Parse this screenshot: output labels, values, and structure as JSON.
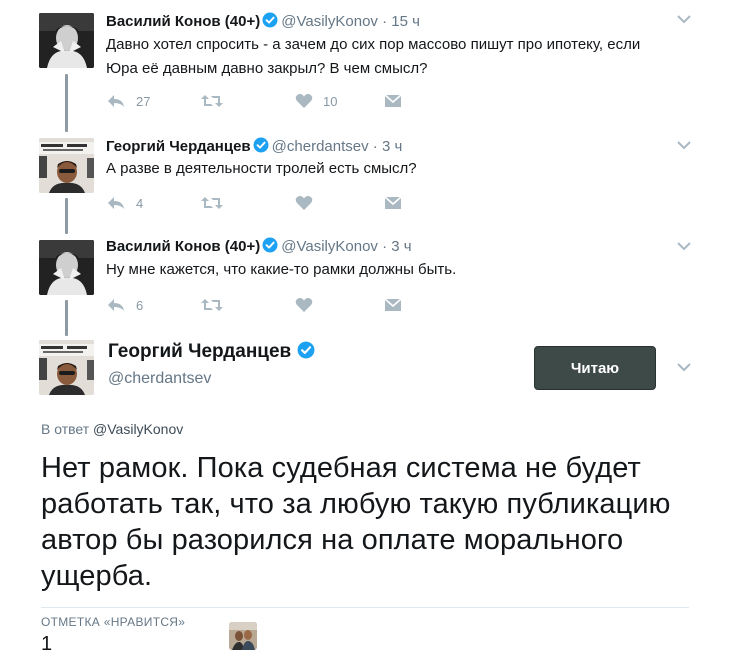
{
  "tweets": [
    {
      "name": "Василий Конов (40+)",
      "handle": "@VasilyKonov",
      "separator": "·",
      "time": "15 ч",
      "text": "Давно хотел спросить - а зачем до сих пор массово пишут про ипотеку, если Юра её давным давно закрыл? В чем смысл?",
      "reply_count": "27",
      "like_count": "10"
    },
    {
      "name": "Георгий Черданцев",
      "handle": "@cherdantsev",
      "separator": "·",
      "time": "3 ч",
      "text": "А разве в деятельности тролей есть смысл?",
      "reply_count": "4",
      "like_count": ""
    },
    {
      "name": "Василий Конов (40+)",
      "handle": "@VasilyKonov",
      "separator": "·",
      "time": "3 ч",
      "text": "Ну мне кажется, что какие-то рамки должны быть.",
      "reply_count": "6",
      "like_count": ""
    }
  ],
  "main_tweet": {
    "name": "Георгий Черданцев",
    "handle": "@cherdantsev",
    "follow_label": "Читаю",
    "reply_prefix": "В ответ",
    "reply_to": "@VasilyKonov",
    "text": "Нет рамок. Пока судебная система не будет работать так, что за любую такую публикацию автор бы разорился на оплате морального ущерба.",
    "likes_label": "ОТМЕТКА «НРАВИТСЯ»",
    "likes_count": "1"
  },
  "icons": {
    "verified": "verified-badge-icon",
    "reply": "reply-icon",
    "retweet": "retweet-icon",
    "like": "heart-icon",
    "dm": "direct-message-icon",
    "more": "chevron-down-icon"
  },
  "colors": {
    "verified": "#1da1f2",
    "thread_line": "#8d9aa3",
    "action_icon": "#aab8c2",
    "follow_button": "#3e4a48"
  }
}
